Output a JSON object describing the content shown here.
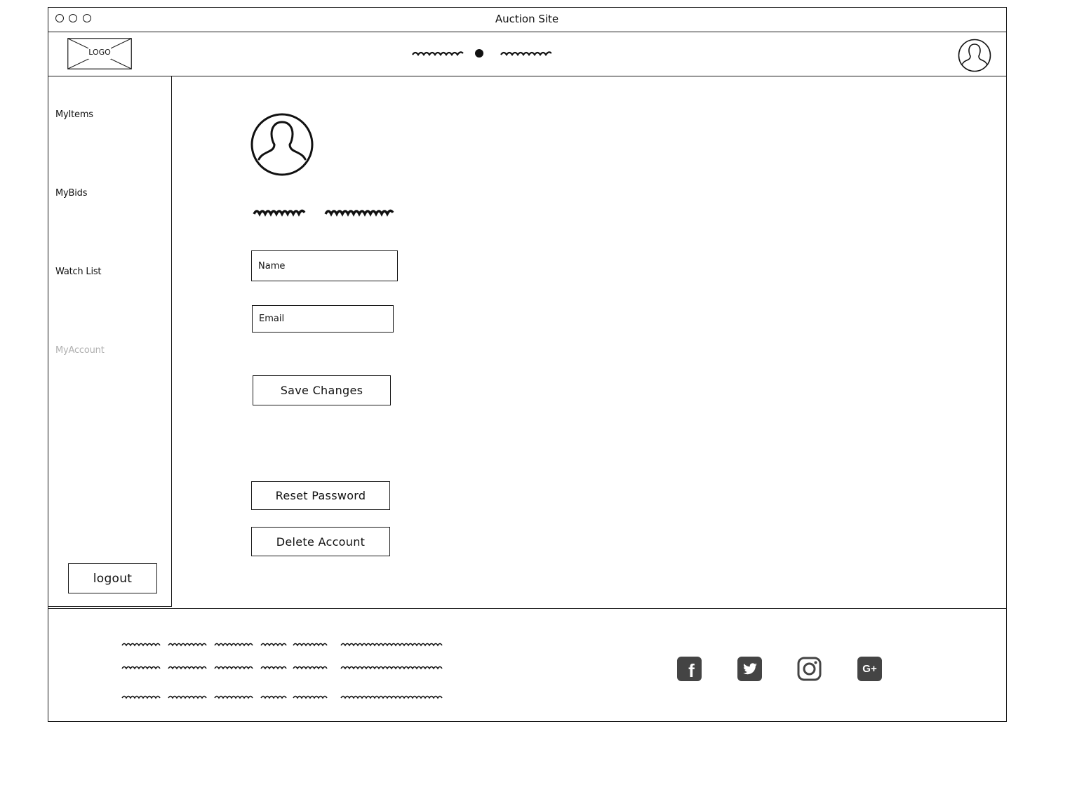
{
  "window": {
    "title": "Auction Site"
  },
  "header": {
    "logo_text": "LOGO",
    "nav_icon": "scribble-dot-scribble",
    "avatar_icon": "user-avatar-icon"
  },
  "sidebar": {
    "items": [
      {
        "label": "MyItems",
        "active": false
      },
      {
        "label": "MyBids",
        "active": false
      },
      {
        "label": "Watch List",
        "active": false
      },
      {
        "label": "MyAccount",
        "active": true
      }
    ],
    "logout_label": "logout"
  },
  "main": {
    "profile_icon": "user-avatar-icon",
    "name_field": {
      "placeholder": "Name"
    },
    "email_field": {
      "placeholder": "Email"
    },
    "save_label": "Save Changes",
    "reset_label": "Reset Password",
    "delete_label": "Delete Account"
  },
  "footer": {
    "social": [
      {
        "icon": "facebook-icon",
        "glyph": "f"
      },
      {
        "icon": "twitter-icon",
        "glyph": ""
      },
      {
        "icon": "instagram-icon",
        "glyph": ""
      },
      {
        "icon": "google-plus-icon",
        "glyph": "G+"
      }
    ]
  },
  "colors": {
    "stroke": "#1a1a1a",
    "active_nav": "#b0b0b0",
    "social_bg": "#444444"
  }
}
